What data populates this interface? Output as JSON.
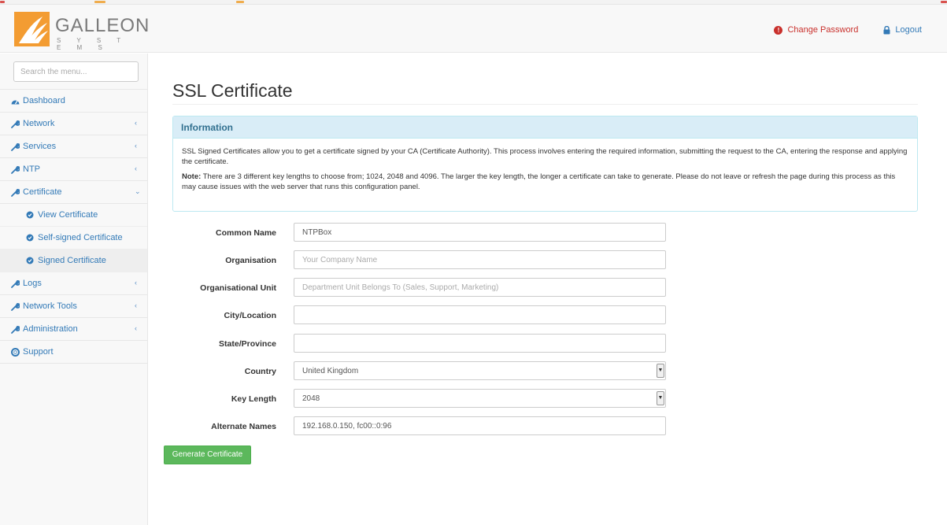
{
  "brand": {
    "name": "GALLEON",
    "tagline": "S Y S T E M S",
    "colors": {
      "orange": "#f39c32",
      "gray": "#7a7a7a"
    }
  },
  "header": {
    "change_password": "Change Password",
    "logout": "Logout"
  },
  "sidebar": {
    "search_placeholder": "Search the menu...",
    "items": [
      {
        "label": "Dashboard",
        "icon": "dashboard-icon",
        "chevron": ""
      },
      {
        "label": "Network",
        "icon": "wrench-icon",
        "chevron": "‹"
      },
      {
        "label": "Services",
        "icon": "wrench-icon",
        "chevron": "‹"
      },
      {
        "label": "NTP",
        "icon": "wrench-icon",
        "chevron": "‹"
      },
      {
        "label": "Certificate",
        "icon": "wrench-icon",
        "chevron": "⌄"
      },
      {
        "label": "Logs",
        "icon": "wrench-icon",
        "chevron": "‹"
      },
      {
        "label": "Network Tools",
        "icon": "wrench-icon",
        "chevron": "‹"
      },
      {
        "label": "Administration",
        "icon": "wrench-icon",
        "chevron": "‹"
      },
      {
        "label": "Support",
        "icon": "lifebuoy-icon",
        "chevron": ""
      }
    ],
    "certificate_subitems": [
      {
        "label": "View Certificate",
        "icon": "certificate-icon"
      },
      {
        "label": "Self-signed Certificate",
        "icon": "certificate-icon"
      },
      {
        "label": "Signed Certificate",
        "icon": "certificate-icon",
        "active": true
      }
    ]
  },
  "page": {
    "title": "SSL Certificate",
    "info": {
      "heading": "Information",
      "paragraph1": "SSL Signed Certificates allow you to get a certificate signed by your CA (Certificate Authority). This process involves entering the required information, submitting the request to the CA, entering the response and applying the certificate.",
      "note_label": "Note:",
      "paragraph2": " There are 3 different key lengths to choose from; 1024, 2048 and 4096. The larger the key length, the longer a certificate can take to generate. Please do not leave or refresh the page during this process as this may cause issues with the web server that runs this configuration panel."
    },
    "form": {
      "common_name": {
        "label": "Common Name",
        "value": "NTPBox",
        "placeholder": ""
      },
      "organisation": {
        "label": "Organisation",
        "value": "",
        "placeholder": "Your Company Name"
      },
      "org_unit": {
        "label": "Organisational Unit",
        "value": "",
        "placeholder": "Department Unit Belongs To (Sales, Support, Marketing)"
      },
      "city": {
        "label": "City/Location",
        "value": "",
        "placeholder": ""
      },
      "state": {
        "label": "State/Province",
        "value": "",
        "placeholder": ""
      },
      "country": {
        "label": "Country",
        "value": "United Kingdom"
      },
      "key_length": {
        "label": "Key Length",
        "value": "2048"
      },
      "alt_names": {
        "label": "Alternate Names",
        "value": "192.168.0.150, fc00::0:96",
        "placeholder": ""
      }
    },
    "submit_label": "Generate Certificate"
  }
}
